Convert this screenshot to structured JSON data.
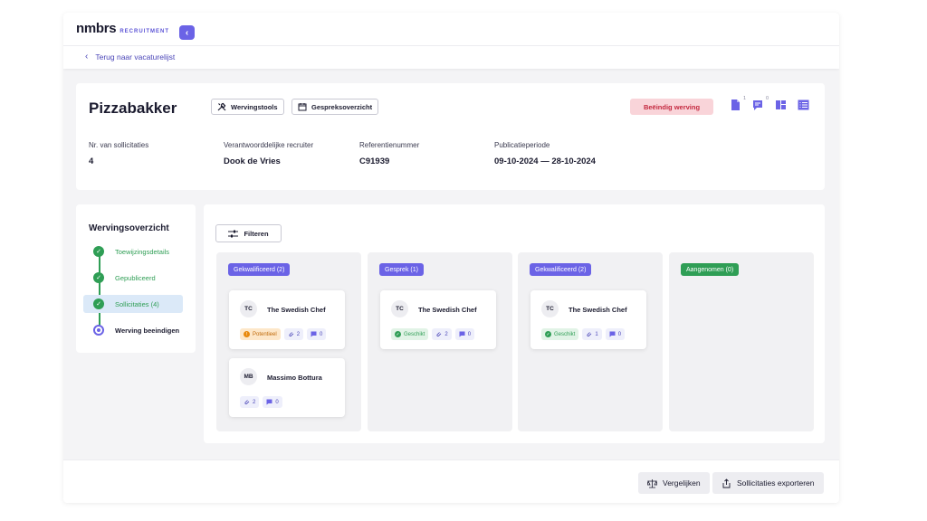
{
  "brand": {
    "name": "nmbrs",
    "product": "RECRUITMENT"
  },
  "nav": {
    "back_label": "Terug naar vacaturelijst"
  },
  "header": {
    "title": "Pizzabakker",
    "tools_label": "Wervingstools",
    "interviews_label": "Gespreksoverzicht",
    "end_label": "Beëindig werving",
    "icon_counts": {
      "documents": "1",
      "comments": "0"
    },
    "meta": [
      {
        "label": "Nr. van sollicitaties",
        "value": "4"
      },
      {
        "label": "Verantwoorddelijke recruiter",
        "value": "Dook de Vries"
      },
      {
        "label": "Referentienummer",
        "value": "C91939"
      },
      {
        "label": "Publicatieperiode",
        "value": "09-10-2024 — 28-10-2024"
      }
    ]
  },
  "sidebar": {
    "title": "Wervingsoverzicht",
    "steps": [
      {
        "label": "Toewijzingsdetails",
        "state": "done"
      },
      {
        "label": "Gepubliceerd",
        "state": "done"
      },
      {
        "label": "Sollicitaties (4)",
        "state": "done-active"
      },
      {
        "label": "Werving beeindigen",
        "state": "current"
      }
    ]
  },
  "board": {
    "filter_label": "Filteren",
    "columns": [
      {
        "label": "Gekwalificeerd (2)",
        "color": "#6b63e6",
        "cards": [
          {
            "initials": "TC",
            "name": "The Swedish Chef",
            "status": "Potentieel",
            "attachments": "2",
            "comments": "0"
          },
          {
            "initials": "MB",
            "name": "Massimo Bottura",
            "status": "",
            "attachments": "2",
            "comments": "0"
          }
        ]
      },
      {
        "label": "Gesprek (1)",
        "color": "#6b63e6",
        "cards": [
          {
            "initials": "TC",
            "name": "The Swedish Chef",
            "status": "Geschikt",
            "attachments": "2",
            "comments": "0"
          }
        ]
      },
      {
        "label": "Gekwalificeerd (2)",
        "color": "#6b63e6",
        "cards": [
          {
            "initials": "TC",
            "name": "The Swedish Chef",
            "status": "Geschikt",
            "attachments": "1",
            "comments": "0"
          }
        ]
      },
      {
        "label": "Aangenomen (0)",
        "color": "#2f9e55",
        "cards": []
      }
    ]
  },
  "footer": {
    "compare_label": "Vergelijken",
    "export_label": "Sollicitaties exporteren"
  }
}
